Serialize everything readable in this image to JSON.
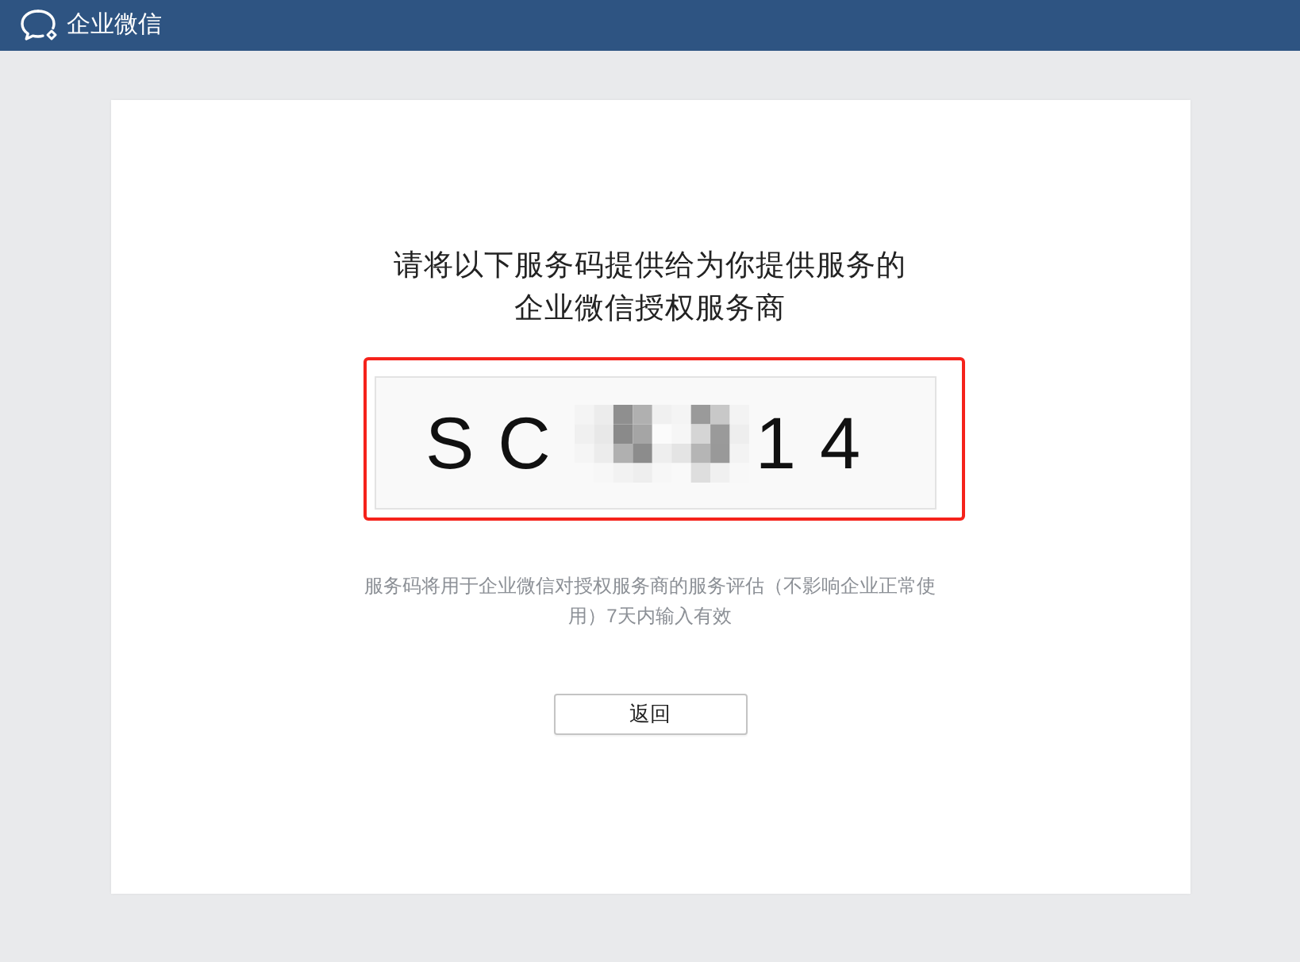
{
  "header": {
    "app_name": "企业微信"
  },
  "card": {
    "instruction": "请将以下服务码提供给为你提供服务的企业微信授权服务商",
    "service_code": {
      "highlighted": true,
      "segments": [
        {
          "kind": "text",
          "text": "SC"
        },
        {
          "kind": "redacted"
        },
        {
          "kind": "text",
          "text": "14"
        }
      ]
    },
    "note": "服务码将用于企业微信对授权服务商的服务评估（不影响企业正常使用）7天内输入有效",
    "button": {
      "label": "返回"
    }
  }
}
